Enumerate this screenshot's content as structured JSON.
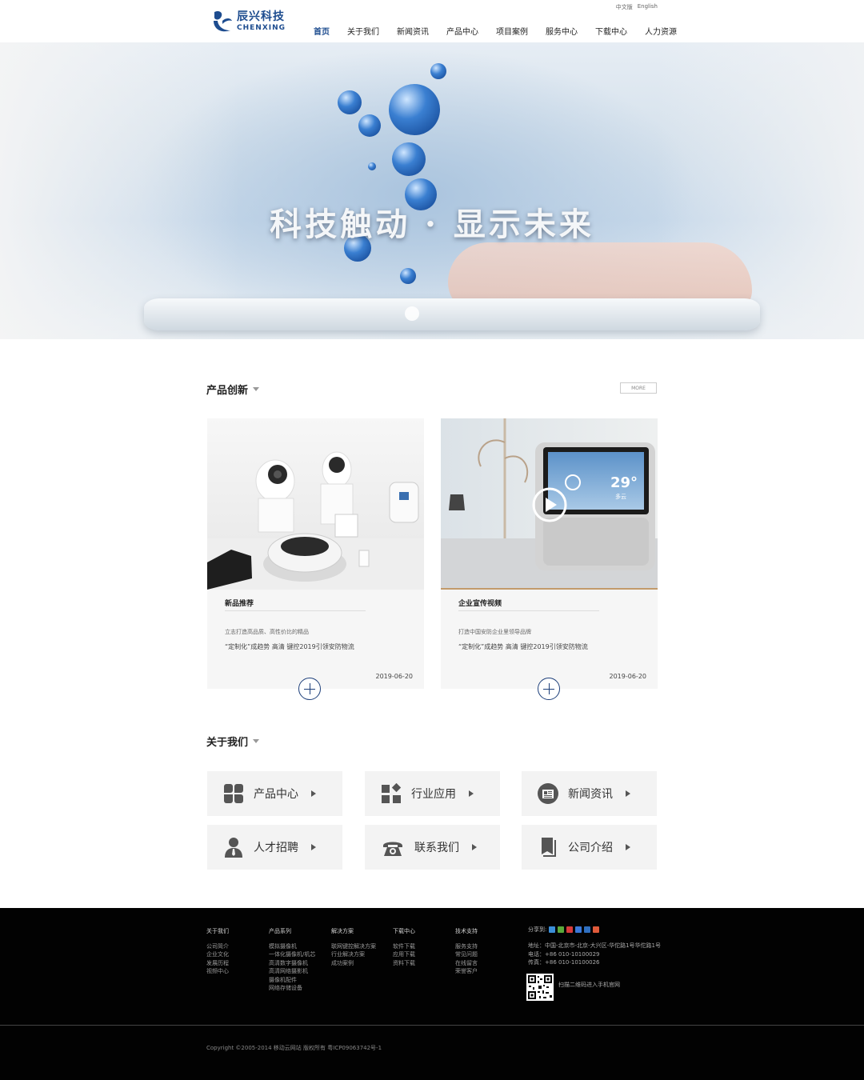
{
  "header": {
    "lang": [
      "中文版",
      "English"
    ],
    "logo_cn": "辰兴科技",
    "logo_en": "CHENXING",
    "nav": [
      "首页",
      "关于我们",
      "新闻资讯",
      "产品中心",
      "项目案例",
      "服务中心",
      "下载中心",
      "人力资源"
    ],
    "active_nav": "首页"
  },
  "banner": {
    "slogan": "科技触动 · 显示未来"
  },
  "products": {
    "title": "产品创新",
    "more": "MORE",
    "cards": [
      {
        "title": "新品推荐",
        "subtitle": "立志打造高品质、高性价比的精品",
        "desc": "“定制化”成趋势 高清 键控2019引领安防物流",
        "date": "2019-06-20"
      },
      {
        "title": "企业宣传视频",
        "subtitle": "打造中国安防企业里领导品牌",
        "desc": "“定制化”成趋势 高清 键控2019引领安防物流",
        "date": "2019-06-20",
        "screen_temp": "29°",
        "screen_weather": "多云"
      }
    ]
  },
  "about": {
    "title": "关于我们",
    "tiles": [
      {
        "label": "产品中心",
        "icon": "grid-blocks-icon"
      },
      {
        "label": "行业应用",
        "icon": "apps-icon"
      },
      {
        "label": "新闻资讯",
        "icon": "newspaper-icon"
      },
      {
        "label": "人才招聘",
        "icon": "person-icon"
      },
      {
        "label": "联系我们",
        "icon": "telephone-icon"
      },
      {
        "label": "公司介绍",
        "icon": "book-icon"
      }
    ]
  },
  "footer": {
    "columns": [
      {
        "head": "关于我们",
        "items": [
          "公司简介",
          "企业文化",
          "发展历程",
          "视频中心"
        ]
      },
      {
        "head": "产品系列",
        "items": [
          "模拟摄像机",
          "一体化摄像机/机芯",
          "高清数字摄像机",
          "高清网络摄影机",
          "摄像机配件",
          "网络存储设备"
        ]
      },
      {
        "head": "解决方案",
        "items": [
          "联网键控解决方案",
          "行业解决方案",
          "成功案例"
        ]
      },
      {
        "head": "下载中心",
        "items": [
          "软件下载",
          "应用下载",
          "资料下载"
        ]
      },
      {
        "head": "技术支持",
        "items": [
          "服务支持",
          "常见问题",
          "在线留言",
          "荣誉客户"
        ]
      }
    ],
    "share_label": "分享到:",
    "address": "地址：中国-北京市-北京-大兴区-华佗路1号华佗路1号",
    "phone": "电话：+86 010-10100029",
    "fax": "传真：+86 010-10100026",
    "qr_text": "扫描二维码进入手机官网",
    "copyright": "Copyright ©2005-2014 移动云网站 版权所有 粤ICP09063742号-1"
  },
  "colors": {
    "brand": "#1d4c8f",
    "footer_bg": "#020202"
  }
}
